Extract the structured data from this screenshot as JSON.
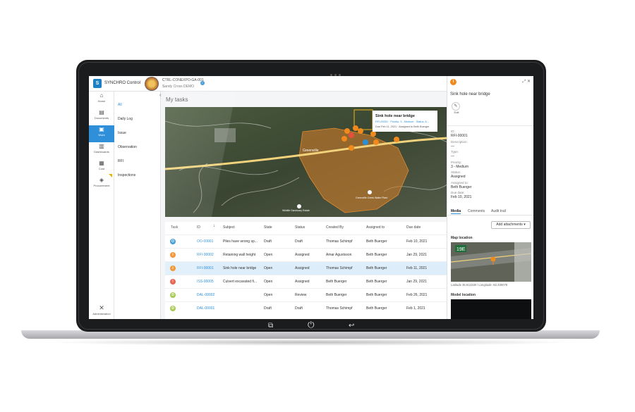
{
  "app": {
    "title": "SYNCHRO Control",
    "project_code": "CTRL-CONEXPO-GA-001",
    "project_name": "Sandy Cross DEMO"
  },
  "left_nav": [
    {
      "label": "Home",
      "icon": "home-icon"
    },
    {
      "label": "Documents",
      "icon": "document-icon"
    },
    {
      "label": "Work",
      "icon": "briefcase-icon",
      "active": true
    },
    {
      "label": "Dashboards",
      "icon": "bar-chart-icon"
    },
    {
      "label": "Cost",
      "icon": "calculator-icon"
    },
    {
      "label": "Procurement",
      "icon": "tag-icon"
    }
  ],
  "admin_label": "Administration",
  "sub_nav": [
    "All",
    "Daily Log",
    "Issue",
    "Observation",
    "RFI",
    "Inspections"
  ],
  "page_title": "My tasks",
  "map": {
    "popup_title": "Sink hole near bridge",
    "popup_line1": "RFI-00001 · Priority: 3 - Medium · Status: A...",
    "popup_line2": "Due Feb 11, 2021 · Assigned to Beth Buerger",
    "label_1": "Greenville",
    "label_2": "Wildlife Sanctuary Estate",
    "label_3": "Greenville Creek Water Plant"
  },
  "table": {
    "headers": [
      "Task",
      "ID",
      "Subject",
      "State",
      "Status",
      "Created By",
      "Assigned to",
      "Due date"
    ],
    "rows": [
      {
        "type": "O",
        "color": "#2c8fd6",
        "id": "OO-00001",
        "subject": "Piles have wrong sp...",
        "state": "Draft",
        "status": "Draft",
        "created_by": "Thomas Schimpf",
        "assigned_to": "Beth Buerger",
        "due": "Feb 10, 2021"
      },
      {
        "type": "i",
        "color": "#f08a1c",
        "id": "RFI-00002",
        "subject": "Retaining wall height",
        "state": "Open",
        "status": "Assigned",
        "created_by": "Amar Agustsson",
        "assigned_to": "Beth Buerger",
        "due": "Jan 29, 2021"
      },
      {
        "type": "i",
        "color": "#f08a1c",
        "id": "RFI-00001",
        "subject": "Sink hole near bridge",
        "state": "Open",
        "status": "Assigned",
        "created_by": "Thomas Schimpf",
        "assigned_to": "Beth Buerger",
        "due": "Feb 11, 2021",
        "selected": true
      },
      {
        "type": "!",
        "color": "#e5503d",
        "id": "ISS-00005",
        "subject": "Culvert excavated fi...",
        "state": "Open",
        "status": "Assigned",
        "created_by": "Beth Buerger",
        "assigned_to": "Beth Buerger",
        "due": "Jan 29, 2021"
      },
      {
        "type": "D",
        "color": "#9cc23a",
        "id": "DAL-00002",
        "subject": "",
        "state": "Open",
        "status": "Review",
        "created_by": "Beth Buerger",
        "assigned_to": "Beth Buerger",
        "due": "Feb 26, 2021"
      },
      {
        "type": "D",
        "color": "#9cc23a",
        "id": "DAL-00001",
        "subject": "",
        "state": "Draft",
        "status": "Draft",
        "created_by": "Thomas Schimpf",
        "assigned_to": "Beth Buerger",
        "due": "Feb 1, 2021"
      }
    ]
  },
  "panel": {
    "title": "Sink hole near bridge",
    "edit_label": "Edit",
    "fields": [
      {
        "label": "ID:",
        "value": "RFI-00001"
      },
      {
        "label": "Description:",
        "value": "—"
      },
      {
        "label": "Type:",
        "value": "—"
      },
      {
        "label": "Priority:",
        "value": "3 - Medium"
      },
      {
        "label": "Status:",
        "value": "Assigned"
      },
      {
        "label": "Assigned to:",
        "value": "Beth Buerger"
      },
      {
        "label": "Due date:",
        "value": "Feb 10, 2021"
      }
    ],
    "tabs": [
      "Media",
      "Comments",
      "Audit trail"
    ],
    "add_attachments": "Add attachments ▾",
    "map_location_label": "Map location",
    "coordinates": "Latitude 35.912238 / Longitude -82.330078",
    "model_location_label": "Model location",
    "thumb_sign": "19E"
  }
}
